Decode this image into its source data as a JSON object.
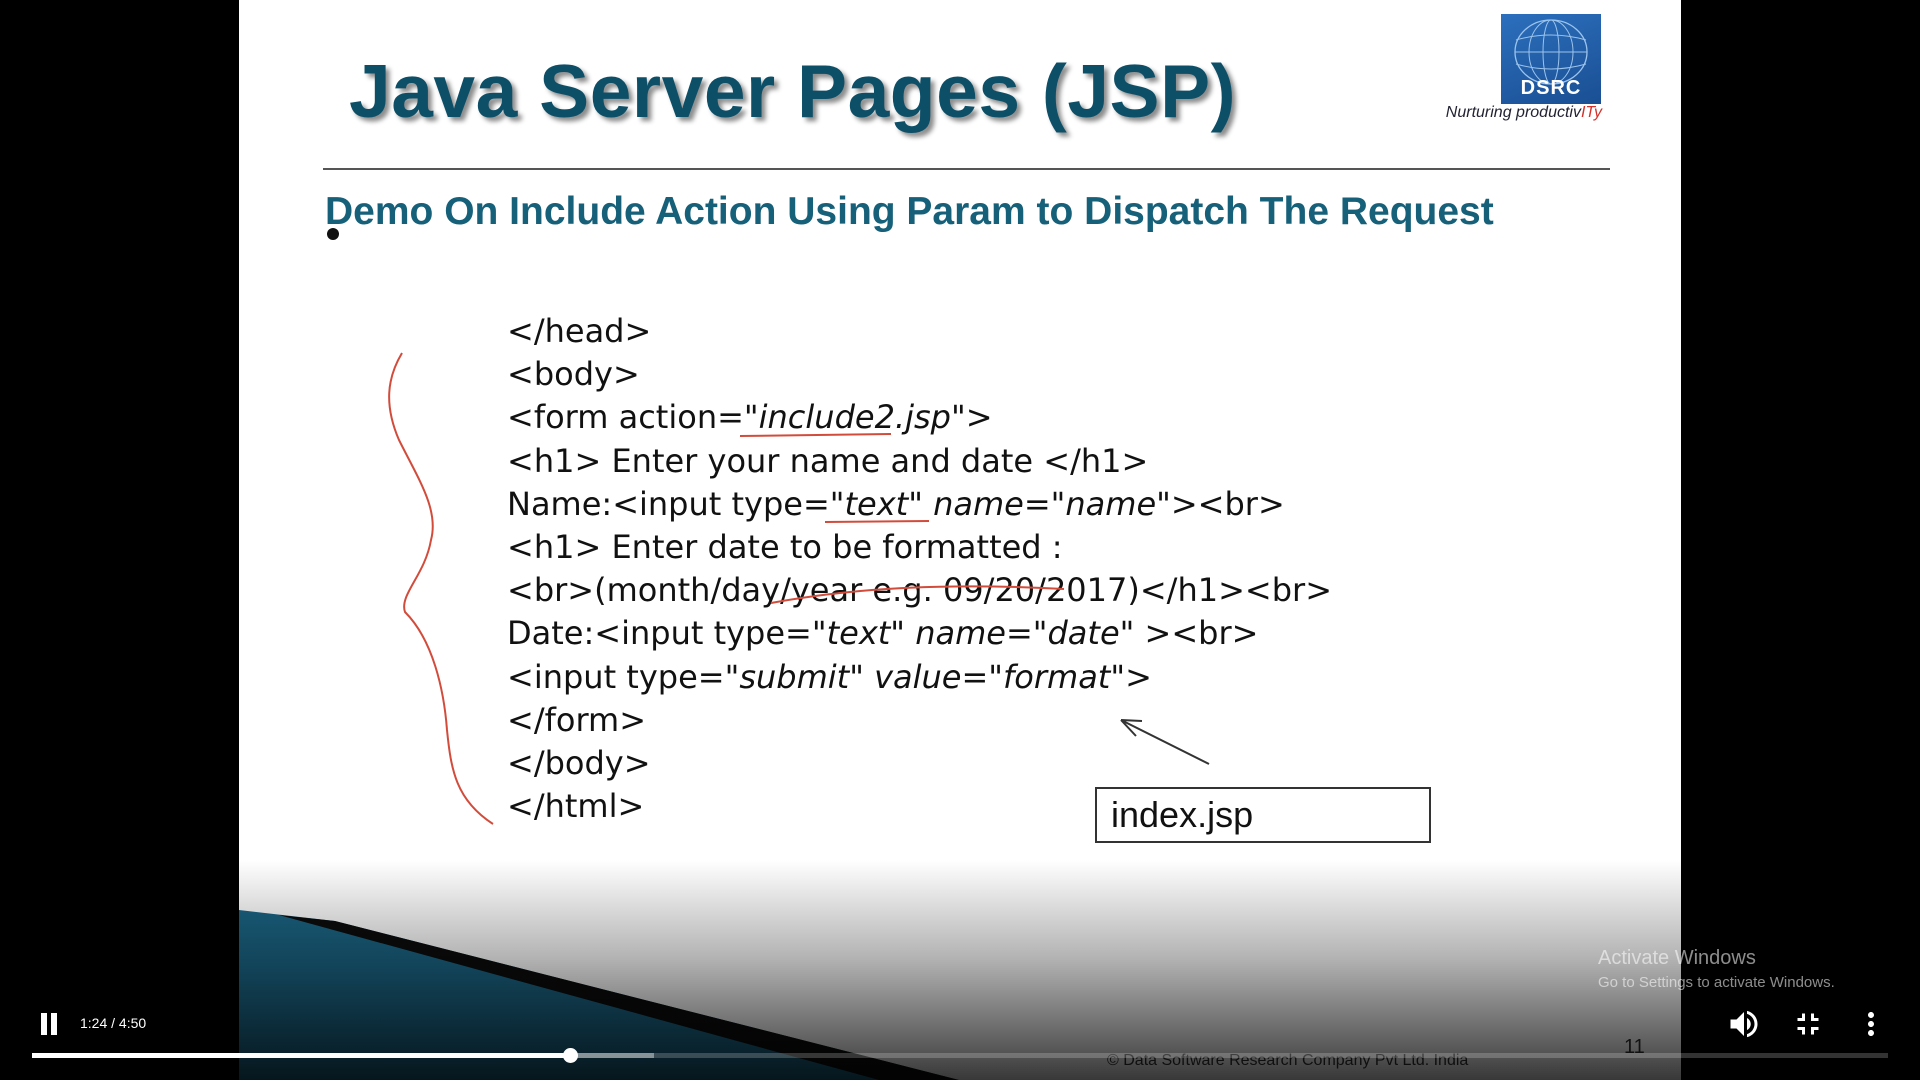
{
  "slide": {
    "title": "Java Server Pages (JSP)",
    "logo": {
      "mark": "DSRC",
      "tagline_main": "Nurturing productiv",
      "tagline_accent": "ITy"
    },
    "subtitle": "Demo On Include Action Using Param to Dispatch The Request",
    "code": {
      "line_head_close": "</head>",
      "line_body_open": "<body>",
      "line_form_pre": "<form action=",
      "line_form_val": "\"include2.jsp\"",
      "line_form_post": ">",
      "line_h1_name": "<h1> Enter your name and date </h1>",
      "line_name_pre": "Name:<input type=",
      "line_name_type": "\"text\"",
      "line_name_attr": " name=\"name\"",
      "line_name_post": "><br>",
      "line_h1_date": "<h1> Enter date to be formatted :",
      "line_br_format": "<br>(month/day/year e.g. 09/20/2017)</h1><br>",
      "line_date_pre": "Date:<input type=",
      "line_date_type": "\"text\"",
      "line_date_attr": " name=\"date\"",
      "line_date_post": "  ><br>",
      "line_submit_pre": "<input type=",
      "line_submit_attr": "\"submit\" value=\"format\"",
      "line_submit_post": ">",
      "line_form_close": "</form>",
      "line_body_close": "</body>",
      "line_html_close": "</html>"
    },
    "file_label": "index.jsp",
    "footer": "© Data Software Research Company Pvt Ltd. India",
    "page_number": "11"
  },
  "watermark": {
    "title": "Activate Windows",
    "subtitle": "Go to Settings to activate Windows."
  },
  "player": {
    "current_time": "1:24",
    "duration": "4:50",
    "time_separator": " / ",
    "state": "playing",
    "progress_fraction": 0.29,
    "buffered_fraction": 0.335,
    "icons": {
      "play_pause": "pause-icon",
      "volume": "volume-icon",
      "fullscreen": "exit-fullscreen-icon",
      "more": "more-options-icon"
    }
  }
}
